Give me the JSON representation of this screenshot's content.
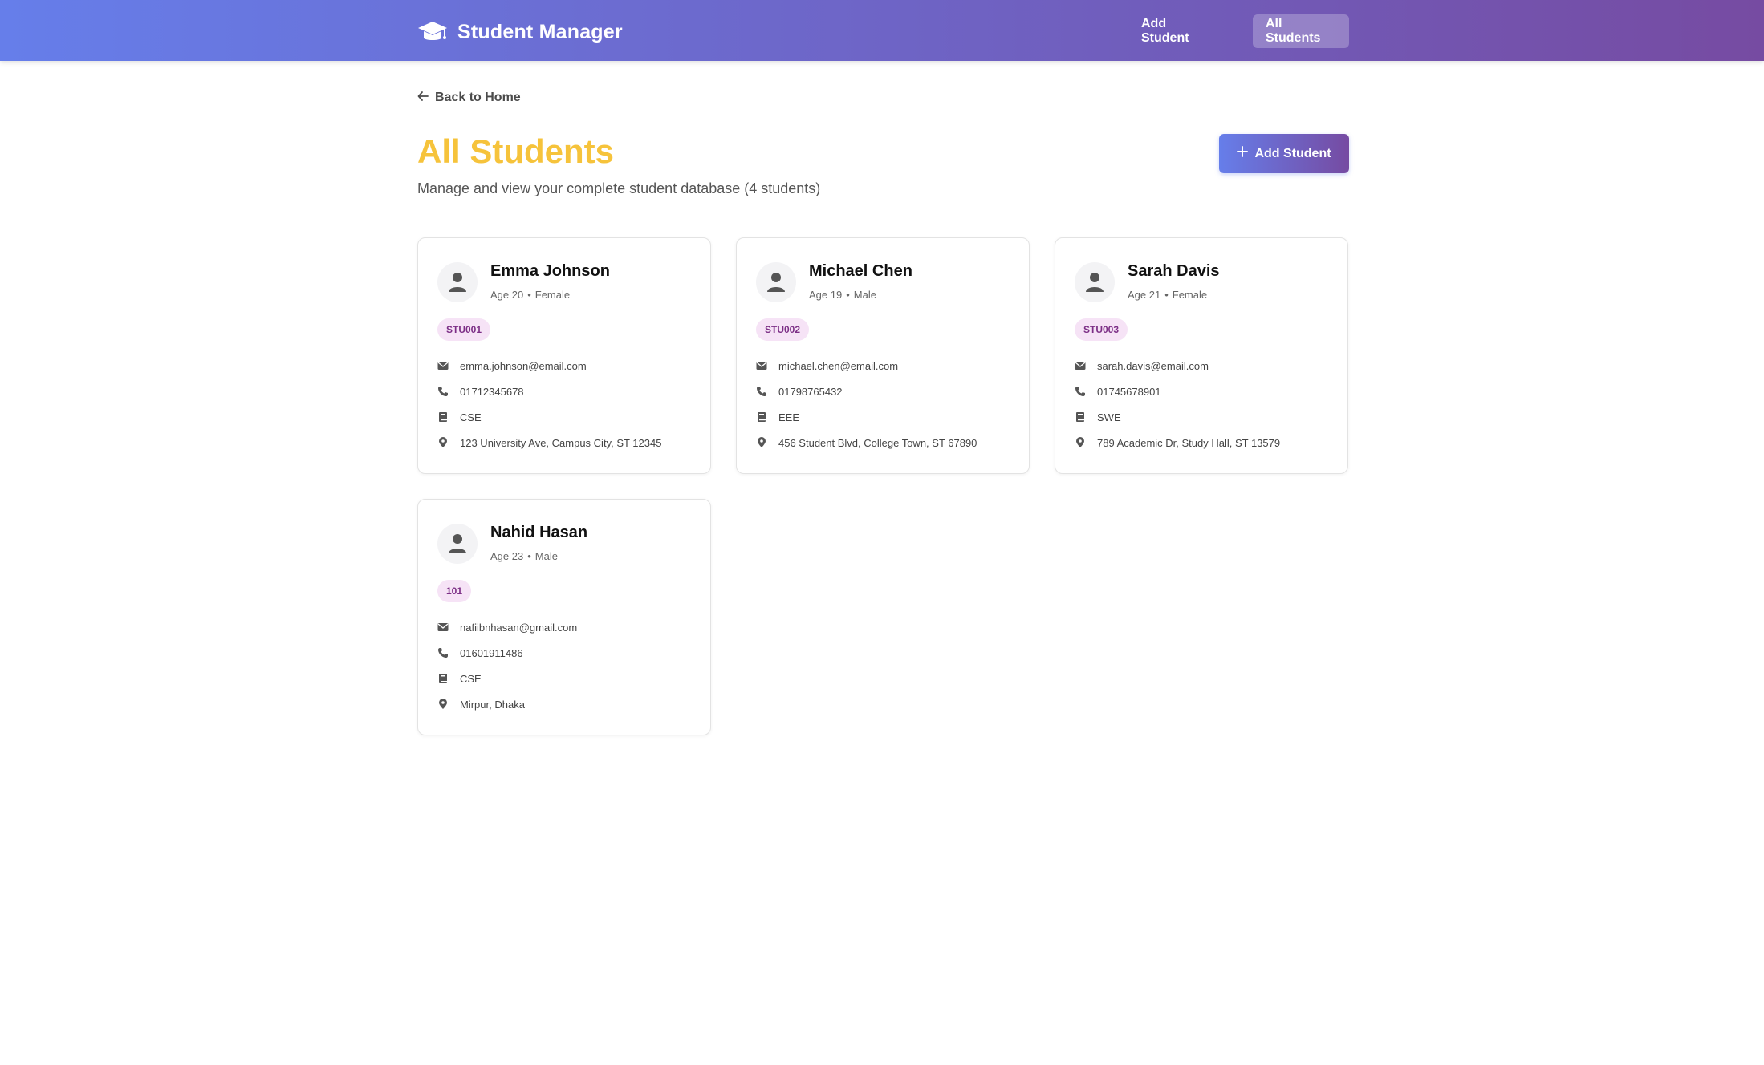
{
  "navbar": {
    "brand": "Student Manager",
    "links": [
      {
        "label": "Add Student"
      },
      {
        "label": "All Students"
      }
    ]
  },
  "back_link": {
    "label": "Back to Home"
  },
  "page": {
    "title": "All Students",
    "subtitle": "Manage and view your complete student database (4 students)",
    "add_button": "Add Student"
  },
  "colors": {
    "gradient_start": "#667eea",
    "gradient_end": "#764ba2",
    "title": "#f6c33b",
    "badge_bg": "#f6e3f6",
    "badge_text": "#7c2f86"
  },
  "students": [
    {
      "name": "Emma Johnson",
      "age": "Age 20",
      "separator": "•",
      "gender": "Female",
      "id": "STU001",
      "email": "emma.johnson@email.com",
      "phone": "01712345678",
      "department": "CSE",
      "address": "123 University Ave, Campus City, ST 12345"
    },
    {
      "name": "Michael Chen",
      "age": "Age 19",
      "separator": "•",
      "gender": "Male",
      "id": "STU002",
      "email": "michael.chen@email.com",
      "phone": "01798765432",
      "department": "EEE",
      "address": "456 Student Blvd, College Town, ST 67890"
    },
    {
      "name": "Sarah Davis",
      "age": "Age 21",
      "separator": "•",
      "gender": "Female",
      "id": "STU003",
      "email": "sarah.davis@email.com",
      "phone": "01745678901",
      "department": "SWE",
      "address": "789 Academic Dr, Study Hall, ST 13579"
    },
    {
      "name": "Nahid Hasan",
      "age": "Age 23",
      "separator": "•",
      "gender": "Male",
      "id": "101",
      "email": "nafiibnhasan@gmail.com",
      "phone": "01601911486",
      "department": "CSE",
      "address": "Mirpur, Dhaka"
    }
  ]
}
